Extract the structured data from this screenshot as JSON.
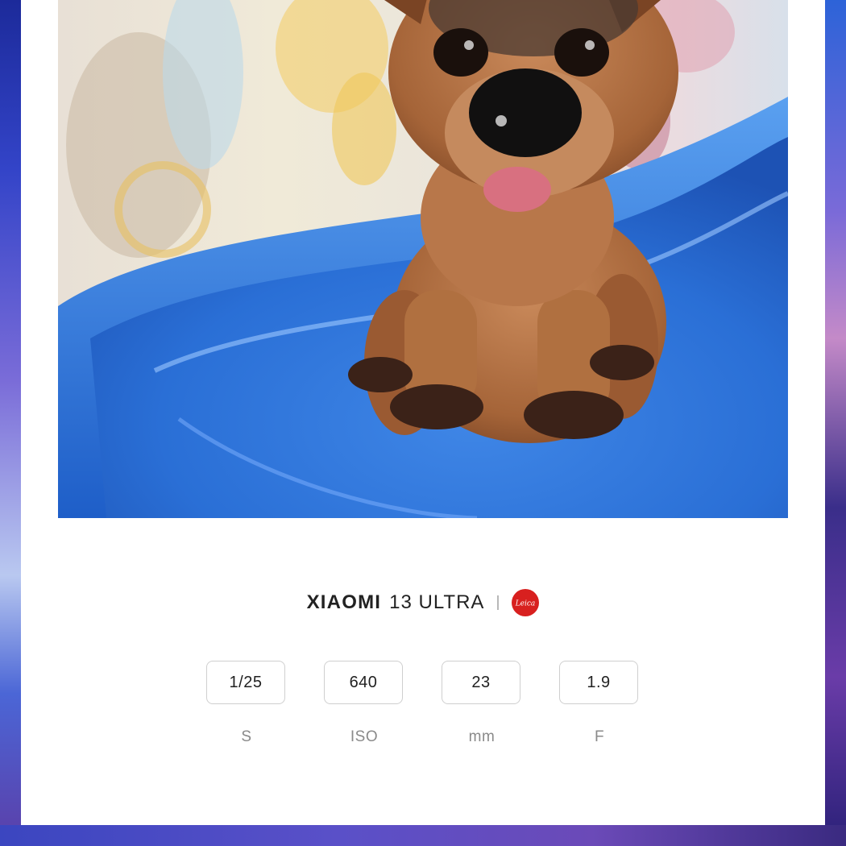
{
  "photo": {
    "subject": "dog-figurine-photo"
  },
  "camera": {
    "brand": "XIAOMI",
    "model": "13 ULTRA",
    "lens_brand_logo": "leica-logo",
    "logo_text": "Leica"
  },
  "specs": [
    {
      "value": "1/25",
      "label": "S"
    },
    {
      "value": "640",
      "label": "ISO"
    },
    {
      "value": "23",
      "label": "mm"
    },
    {
      "value": "1.9",
      "label": "F"
    }
  ],
  "colors": {
    "card": "#ffffff",
    "leica_red": "#d8201f",
    "text_dark": "#222222",
    "text_muted": "#8a8a8a"
  }
}
